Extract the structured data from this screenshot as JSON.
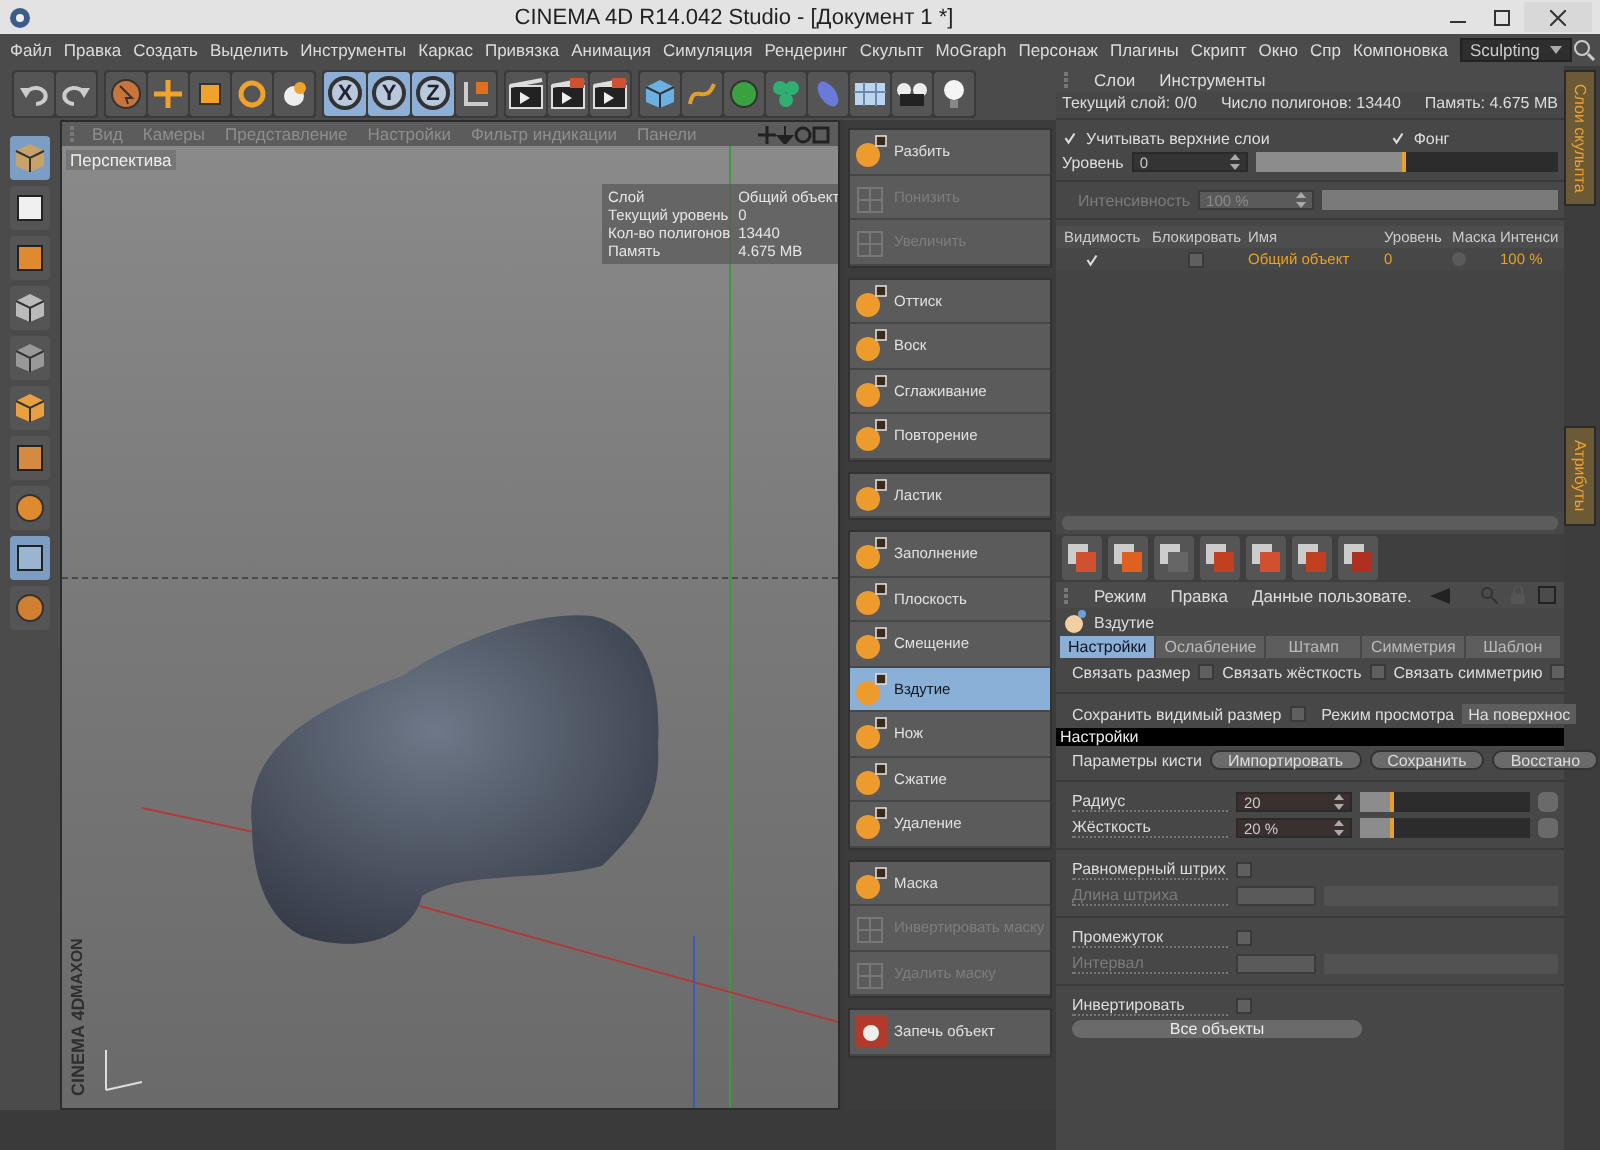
{
  "window": {
    "title": "CINEMA 4D R14.042 Studio - [Документ 1 *]"
  },
  "menu": [
    "Файл",
    "Правка",
    "Создать",
    "Выделить",
    "Инструменты",
    "Каркас",
    "Привязка",
    "Анимация",
    "Симуляция",
    "Рендеринг",
    "Скульпт",
    "MoGraph",
    "Персонаж",
    "Плагины",
    "Скрипт",
    "Окно",
    "Спр",
    "Компоновка"
  ],
  "layout_select": {
    "value": "Sculpting"
  },
  "toolbar": {
    "axes": [
      {
        "label": "X",
        "selected": true
      },
      {
        "label": "Y",
        "selected": true
      },
      {
        "label": "Z",
        "selected": true
      }
    ]
  },
  "viewport": {
    "menu": [
      "Вид",
      "Камеры",
      "Представление",
      "Настройки",
      "Фильтр индикации",
      "Панели"
    ],
    "camera": "Перспектива",
    "info": [
      {
        "label": "Слой",
        "value": "Общий объект"
      },
      {
        "label": "Текущий уровень",
        "value": "0"
      },
      {
        "label": "Кол-во полигонов",
        "value": "13440"
      },
      {
        "label": "Память",
        "value": "4.675 MB"
      }
    ],
    "logo": [
      "MAXON",
      "CINEMA 4D"
    ]
  },
  "sculpt_tools": [
    {
      "items": [
        {
          "label": "Разбить",
          "kind": "brush",
          "disabled": false,
          "selected": false
        },
        {
          "label": "Понизить",
          "kind": "mesh",
          "disabled": true,
          "selected": false
        },
        {
          "label": "Увеличить",
          "kind": "mesh",
          "disabled": true,
          "selected": false
        }
      ]
    },
    {
      "items": [
        {
          "label": "Оттиск",
          "kind": "brush",
          "disabled": false,
          "selected": false
        },
        {
          "label": "Воск",
          "kind": "brush",
          "disabled": false,
          "selected": false
        },
        {
          "label": "Сглаживание",
          "kind": "brush",
          "disabled": false,
          "selected": false
        },
        {
          "label": "Повторение",
          "kind": "brush",
          "disabled": false,
          "selected": false
        }
      ]
    },
    {
      "items": [
        {
          "label": "Ластик",
          "kind": "brush",
          "disabled": false,
          "selected": false
        }
      ]
    },
    {
      "items": [
        {
          "label": "Заполнение",
          "kind": "brush",
          "disabled": false,
          "selected": false
        },
        {
          "label": "Плоскость",
          "kind": "brush",
          "disabled": false,
          "selected": false
        },
        {
          "label": "Смещение",
          "kind": "brush",
          "disabled": false,
          "selected": false
        },
        {
          "label": "Вздутие",
          "kind": "brush",
          "disabled": false,
          "selected": true
        },
        {
          "label": "Нож",
          "kind": "brush",
          "disabled": false,
          "selected": false
        },
        {
          "label": "Сжатие",
          "kind": "brush",
          "disabled": false,
          "selected": false
        },
        {
          "label": "Удаление",
          "kind": "brush",
          "disabled": false,
          "selected": false
        }
      ]
    },
    {
      "items": [
        {
          "label": "Маска",
          "kind": "brush",
          "disabled": false,
          "selected": false
        },
        {
          "label": "Инвертировать маску",
          "kind": "mesh",
          "disabled": true,
          "selected": false
        },
        {
          "label": "Удалить маску",
          "kind": "mesh",
          "disabled": true,
          "selected": false
        }
      ]
    },
    {
      "items": [
        {
          "label": "Запечь объект",
          "kind": "bake",
          "disabled": false,
          "selected": false
        }
      ]
    }
  ],
  "layers_panel": {
    "menu": [
      "Слои",
      "Инструменты"
    ],
    "info": [
      "Текущий слой: 0/0",
      "Число полигонов: 13440",
      "Память: 4.675 MB"
    ],
    "options": [
      {
        "label": "Учитывать верхние слои",
        "checked": true
      },
      {
        "label": "Фонг",
        "checked": true
      }
    ],
    "level_slider": {
      "label": "Уровень",
      "value": "0",
      "level": 0.5
    },
    "intensity": {
      "label": "Интенсивность",
      "value": "100 %",
      "disabled": true,
      "level": 1
    },
    "columns": [
      "Видимость",
      "Блокировать",
      "Имя",
      "Уровень",
      "Маска",
      "Интенси"
    ],
    "rows": [
      {
        "visible": true,
        "locked": false,
        "name": "Общий объект",
        "layer_level": "0",
        "intensity": "100 %"
      }
    ]
  },
  "attributes_panel": {
    "menu": [
      "Режим",
      "Правка",
      "Данные пользовате."
    ],
    "tool": "Вздутие",
    "tabs": [
      {
        "label": "Настройки",
        "selected": true
      },
      {
        "label": "Ослабление",
        "selected": false
      },
      {
        "label": "Штамп",
        "selected": false
      },
      {
        "label": "Симметрия",
        "selected": false
      },
      {
        "label": "Шаблон",
        "selected": false
      }
    ],
    "link_options": [
      {
        "label": "Связать размер",
        "checked": false
      },
      {
        "label": "Связать жёсткость",
        "checked": false
      },
      {
        "label": "Связать симметрию",
        "checked": false
      }
    ],
    "keep_size": {
      "label": "Сохранить видимый размер",
      "checked": false
    },
    "view_mode": {
      "label": "Режим просмотра",
      "value": "На поверхнос"
    },
    "section": "Настройки",
    "brush_params": {
      "label": "Параметры кисти",
      "buttons": [
        "Импортировать",
        "Сохранить",
        "Восстано"
      ]
    },
    "sliders": [
      {
        "label": "Радиус",
        "value": "20",
        "level": 0.2
      },
      {
        "label": "Жёсткость",
        "value": "20 %",
        "level": 0.2
      }
    ],
    "stroke_options": [
      {
        "label": "Равномерный штрих",
        "checked": false,
        "field": {
          "label": "Длина штриха",
          "disabled": true
        }
      },
      {
        "label": "Промежуток",
        "checked": false,
        "field": {
          "label": "Интервал",
          "disabled": true
        }
      }
    ],
    "invert": {
      "label": "Инвертировать",
      "checked": false
    },
    "apply_button": "Все объекты"
  },
  "side_tabs": [
    {
      "label": "Слои скульпта",
      "selected": true
    },
    {
      "label": "Атрибуты",
      "selected": true
    }
  ]
}
